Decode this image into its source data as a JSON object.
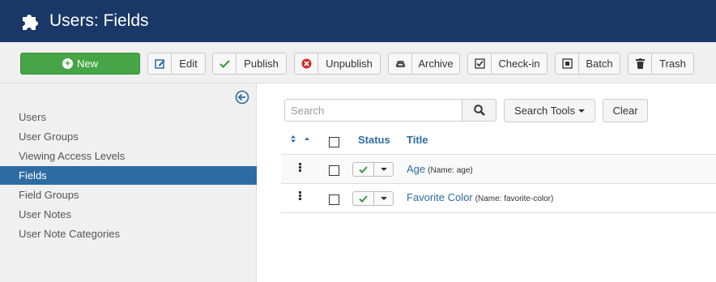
{
  "header": {
    "title": "Users: Fields",
    "icon": "puzzle-icon"
  },
  "toolbar": {
    "new_label": "New",
    "edit_label": "Edit",
    "publish_label": "Publish",
    "unpublish_label": "Unpublish",
    "archive_label": "Archive",
    "checkin_label": "Check-in",
    "batch_label": "Batch",
    "trash_label": "Trash"
  },
  "sidebar": {
    "items": [
      {
        "label": "Users",
        "active": false
      },
      {
        "label": "User Groups",
        "active": false
      },
      {
        "label": "Viewing Access Levels",
        "active": false
      },
      {
        "label": "Fields",
        "active": true
      },
      {
        "label": "Field Groups",
        "active": false
      },
      {
        "label": "User Notes",
        "active": false
      },
      {
        "label": "User Note Categories",
        "active": false
      }
    ]
  },
  "filters": {
    "search_placeholder": "Search",
    "search_value": "",
    "search_tools_label": "Search Tools",
    "clear_label": "Clear"
  },
  "table": {
    "columns": {
      "status": "Status",
      "title": "Title"
    },
    "rows": [
      {
        "title": "Age",
        "name_note": "(Name: age)",
        "published": true
      },
      {
        "title": "Favorite Color",
        "name_note": "(Name: favorite-color)",
        "published": true
      }
    ]
  },
  "colors": {
    "header_bg": "#1a3867",
    "new_button": "#46a546",
    "link": "#2d6ca2",
    "active_sidebar": "#2d6ca2",
    "published_check": "#3c9c3c",
    "unpublish_icon": "#c8302b"
  }
}
